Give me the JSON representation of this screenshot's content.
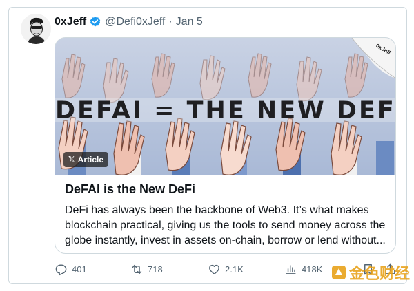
{
  "author": {
    "name": "0xJeff",
    "handle": "@Defi0xJeff",
    "date": "Jan 5"
  },
  "card": {
    "cover_title": "DEFAI = THE NEW DEFI",
    "cover_corner_tag": "0xJeff",
    "badge": "Article",
    "title": "DeFAI is the New DeFi",
    "description": "DeFi has always been the backbone of Web3. It’s what makes blockchain practical, giving us the tools to send money across the globe instantly, invest in assets on-chain, borrow or lend without..."
  },
  "actions": {
    "replies": "401",
    "reposts": "718",
    "likes": "2.1K",
    "views": "418K"
  },
  "watermark": "金色财经",
  "colors": {
    "verified": "#1d9bf0",
    "muted": "#536471",
    "text": "#0f1419"
  }
}
